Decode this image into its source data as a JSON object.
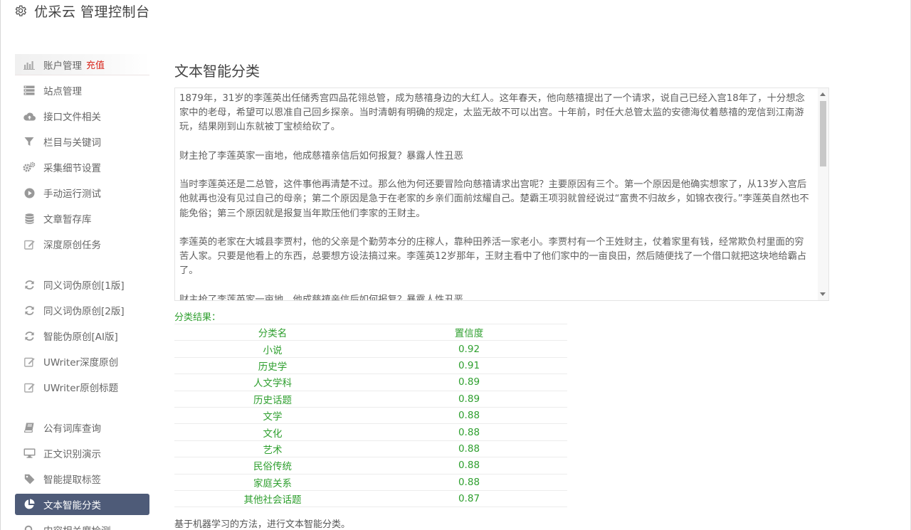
{
  "app": {
    "title": "优采云 管理控制台"
  },
  "sidebar": {
    "items": [
      {
        "label": "账户管理",
        "icon": "bar-chart-icon",
        "badge": "充值"
      },
      {
        "label": "站点管理",
        "icon": "server-icon"
      },
      {
        "label": "接口文件相关",
        "icon": "cloud-upload-icon"
      },
      {
        "label": "栏目与关键词",
        "icon": "filter-icon"
      },
      {
        "label": "采集细节设置",
        "icon": "gears-icon"
      },
      {
        "label": "手动运行测试",
        "icon": "play-icon"
      },
      {
        "label": "文章暂存库",
        "icon": "database-icon"
      },
      {
        "label": "深度原创任务",
        "icon": "edit-icon"
      },
      {
        "label": "同义词伪原创[1版]",
        "icon": "refresh-icon"
      },
      {
        "label": "同义词伪原创[2版]",
        "icon": "refresh-icon"
      },
      {
        "label": "智能伪原创[AI版]",
        "icon": "refresh-icon"
      },
      {
        "label": "UWriter深度原创",
        "icon": "edit-icon"
      },
      {
        "label": "UWriter原创标题",
        "icon": "edit-icon"
      },
      {
        "label": "公有词库查询",
        "icon": "book-icon"
      },
      {
        "label": "正文识别演示",
        "icon": "monitor-icon"
      },
      {
        "label": "智能提取标签",
        "icon": "tag-icon"
      },
      {
        "label": "文本智能分类",
        "icon": "pie-chart-icon",
        "active": true
      },
      {
        "label": "内容相关度检测",
        "icon": "search-icon"
      }
    ]
  },
  "main": {
    "title": "文本智能分类",
    "text_paragraphs": [
      "1879年，31岁的李莲英出任储秀宫四品花翎总管，成为慈禧身边的大红人。这年春天，他向慈禧提出了一个请求，说自己已经入宫18年了，十分想念家中的老母，希望可以恩准自己回乡探亲。当时清朝有明确的规定，太监无故不可以出宫。十年前，时任大总管太监的安德海仗着慈禧的宠信到江南游玩，结果刚到山东就被丁宝桢给砍了。",
      "财主抢了李莲英家一亩地，他成慈禧亲信后如何报复？暴露人性丑恶",
      "当时李莲英还是二总管，这件事他再清楚不过。那么他为何还要冒险向慈禧请求出宫呢？主要原因有三个。第一个原因是他确实想家了，从13岁入宫后他就再也没有见过自己的母亲；第二个原因是急于在老家的乡亲们面前炫耀自己。楚霸王项羽就曾经说过“富贵不归故乡，如锦衣夜行。”李莲英自然也不能免俗；第三个原因就是报复当年欺压他们李家的王财主。",
      "李莲英的老家在大城县李贾村，他的父亲是个勤劳本分的庄稼人，靠种田养活一家老小。李贾村有一个王姓财主，仗着家里有钱，经常欺负村里面的穷苦人家。只要是他看上的东西，总要想方设法搞过来。李莲英12岁那年，王财主看中了他们家中的一亩良田，然后随便找了一个借口就把这块地给霸占了。",
      "财主抢了李莲英家一亩地，他成慈禧亲信后如何报复？暴露人性丑恶"
    ],
    "result_label": "分类结果：",
    "table": {
      "headers": [
        "分类名",
        "置信度"
      ],
      "rows": [
        [
          "小说",
          "0.92"
        ],
        [
          "历史学",
          "0.91"
        ],
        [
          "人文学科",
          "0.89"
        ],
        [
          "历史话题",
          "0.89"
        ],
        [
          "文学",
          "0.88"
        ],
        [
          "文化",
          "0.88"
        ],
        [
          "艺术",
          "0.88"
        ],
        [
          "民俗传统",
          "0.88"
        ],
        [
          "家庭关系",
          "0.88"
        ],
        [
          "其他社会话题",
          "0.87"
        ]
      ]
    },
    "footer_note": "基于机器学习的方法，进行文本智能分类。"
  },
  "colors": {
    "active_nav_bg": "#4e5b78",
    "result_green": "#2e9f2e",
    "badge_red": "#d9261c"
  }
}
